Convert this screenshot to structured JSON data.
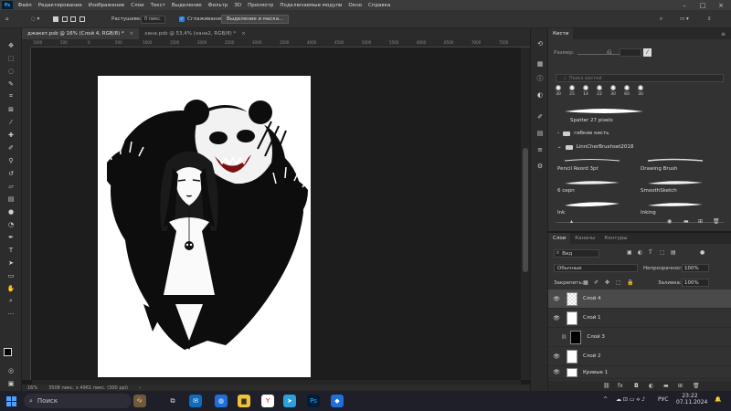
{
  "menubar": {
    "app_logo": "Ps",
    "items": [
      "Файл",
      "Редактирование",
      "Изображение",
      "Слои",
      "Текст",
      "Выделение",
      "Фильтр",
      "3D",
      "Просмотр",
      "Подключаемые модули",
      "Окно",
      "Справка"
    ],
    "window_controls": [
      "–",
      "□",
      "×"
    ]
  },
  "options": {
    "feather_label": "Растушевка:",
    "feather_value": "0 пикс.",
    "antialias_label": "Сглаживание",
    "select_mask_button": "Выделение и маска..."
  },
  "tabs": [
    {
      "label": "джакет.psb @ 16% (Слой 4, RGB/8) *",
      "close": "×"
    },
    {
      "label": "хана.psb @ 53,4% (хана2, RGB/8) *",
      "close": "×"
    }
  ],
  "ruler_ticks": [
    "1000",
    "500",
    "0",
    "500",
    "1000",
    "1500",
    "2000",
    "2500",
    "3000",
    "3500",
    "4000",
    "4500",
    "5000",
    "5500",
    "6000",
    "6500",
    "7000",
    "7500"
  ],
  "status": {
    "zoom": "16%",
    "doc_info": "3508 пикс. x 4961 пикс. (300 ppi)"
  },
  "brushes_panel": {
    "tab": "Кисти",
    "size_label": "Размер:",
    "search_placeholder": "Поиск кистей",
    "preset_sizes": [
      "30",
      "25",
      "14",
      "22",
      "30",
      "60",
      "30"
    ],
    "brushes": [
      {
        "label": "Spatter 27 pixels"
      },
      {
        "label": "Pencil Reord 3pt"
      },
      {
        "label": "Drawing Brush"
      },
      {
        "label": "6 серп"
      },
      {
        "label": "SmoothSketch"
      },
      {
        "label": "Ink"
      },
      {
        "label": "Inking"
      }
    ],
    "folders": [
      "гибкие кисть",
      "LinnCherBrushset2018"
    ]
  },
  "layers_panel": {
    "tabs": [
      "Слои",
      "Каналы",
      "Контуры"
    ],
    "filter_label": "Вид",
    "blend_mode": "Обычные",
    "opacity_label": "Непрозрачность:",
    "opacity_value": "100%",
    "lock_label": "Закрепить:",
    "fill_label": "Заливка:",
    "fill_value": "100%",
    "layers": [
      {
        "name": "Слой 4",
        "visible": true,
        "active": true
      },
      {
        "name": "Слой 1",
        "visible": true,
        "active": false
      },
      {
        "name": "Слой 3",
        "visible": false,
        "active": false
      },
      {
        "name": "Слой 2",
        "visible": true,
        "active": false
      },
      {
        "name": "Кривые 1",
        "visible": true,
        "active": false
      }
    ]
  },
  "taskbar": {
    "search_label": "Поиск",
    "lang": "РУС",
    "time": "23:22",
    "date": "07.11.2024"
  }
}
